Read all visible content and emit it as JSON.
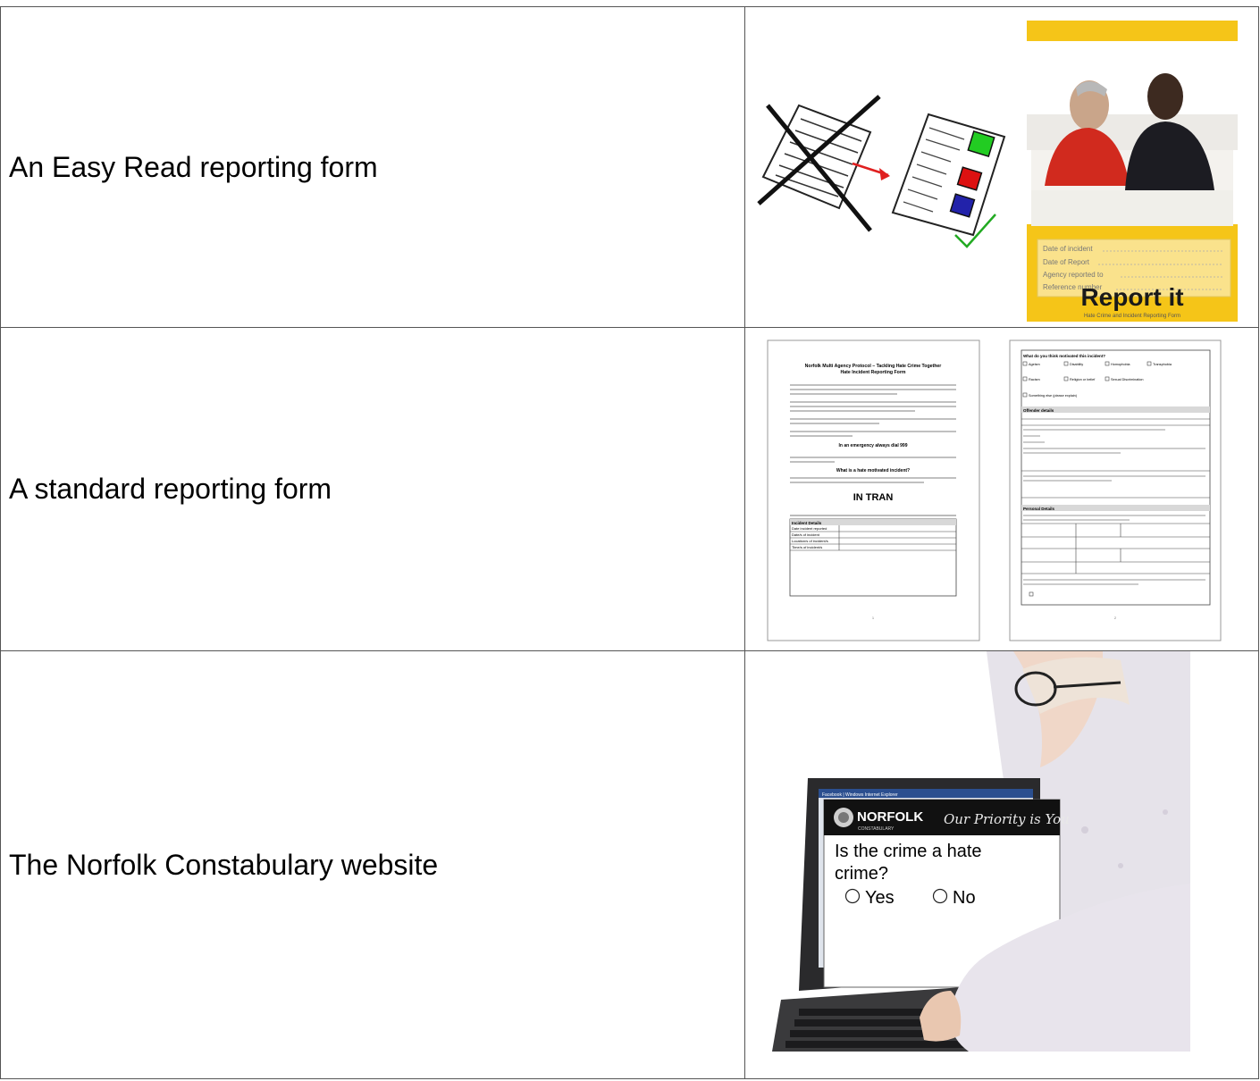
{
  "rows": [
    {
      "label": "An Easy Read reporting form",
      "image": "easy-read-form-illustration"
    },
    {
      "label": "A standard reporting form",
      "image": "standard-form-pages"
    },
    {
      "label": "The Norfolk Constabulary website",
      "image": "laptop-website-photo"
    }
  ],
  "easy_read_cover": {
    "fields": [
      "Date of incident",
      "Date of Report",
      "Agency reported to",
      "Reference number"
    ],
    "title": "Report it",
    "subtitle": "Hate Crime and Incident Reporting Form"
  },
  "standard_form": {
    "page1_title": "Norfolk Multi Agency Protocol – Tackling Hate Crime Together",
    "page1_subtitle": "Hate Incident Reporting Form",
    "page1_emergency": "In an emergency always dial 999",
    "page1_question": "What is a hate motivated incident?",
    "page1_logo": "IN TRAN",
    "page1_section": "Incident Details",
    "page1_rows": [
      "Date incident reported",
      "Date/s of incident",
      "Location/s of incident/s",
      "Time/s of incident/s"
    ],
    "page1_number": "1",
    "page2_heading": "What do you think motivated this incident?",
    "page2_options": [
      "Ageism",
      "Disability",
      "Homophobia",
      "Transphobia",
      "Racism",
      "Religion or belief",
      "Sexual Discrimination",
      "Something else (please explain)"
    ],
    "page2_offender": "Offender details",
    "page2_personal": "Personal Details",
    "page2_number": "2"
  },
  "website": {
    "logo": "NORFOLK",
    "logo_sub": "CONSTABULARY",
    "tagline": "Our Priority is You",
    "question": "Is the crime a hate crime?",
    "options": [
      "Yes",
      "No"
    ],
    "browser_title": "Facebook | Windows Internet Explorer"
  }
}
